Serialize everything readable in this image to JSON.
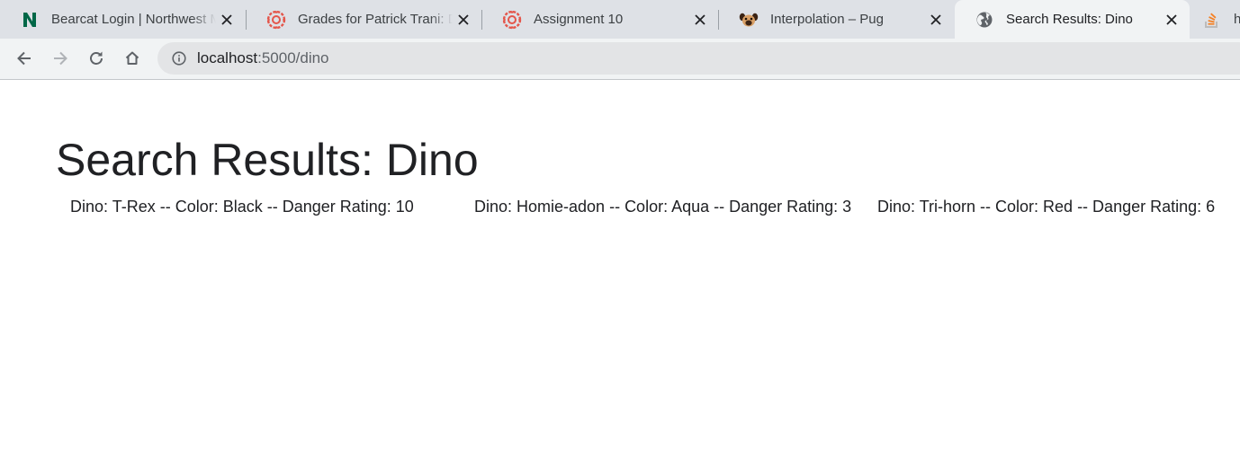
{
  "browser": {
    "tabs": [
      {
        "title": "Bearcat Login | Northwest Missouri State University",
        "icon": "northwest-n-icon",
        "active": false
      },
      {
        "title": "Grades for Patrick Trani: DEV",
        "icon": "canvas-icon",
        "active": false
      },
      {
        "title": "Assignment 10",
        "icon": "canvas-icon",
        "active": false
      },
      {
        "title": "Interpolation – Pug",
        "icon": "pug-icon",
        "active": false
      },
      {
        "title": "Search Results: Dino",
        "icon": "globe-icon",
        "active": true
      },
      {
        "title": "ht",
        "icon": "stackoverflow-icon",
        "active": false
      }
    ],
    "address": {
      "host": "localhost",
      "path": ":5000/dino"
    }
  },
  "page": {
    "title": "Search Results: Dino",
    "results": [
      "Dino: T-Rex -- Color: Black -- Danger Rating: 10",
      "Dino: Homie-adon -- Color: Aqua -- Danger Rating: 3",
      "Dino: Tri-horn -- Color: Red -- Danger Rating: 6"
    ]
  },
  "colors": {
    "tab_strip": "#dee1e6",
    "active_tab": "#f1f3f4",
    "canvas_red": "#e4554a",
    "northwest_green": "#006747",
    "stackoverflow_orange": "#f48024"
  }
}
